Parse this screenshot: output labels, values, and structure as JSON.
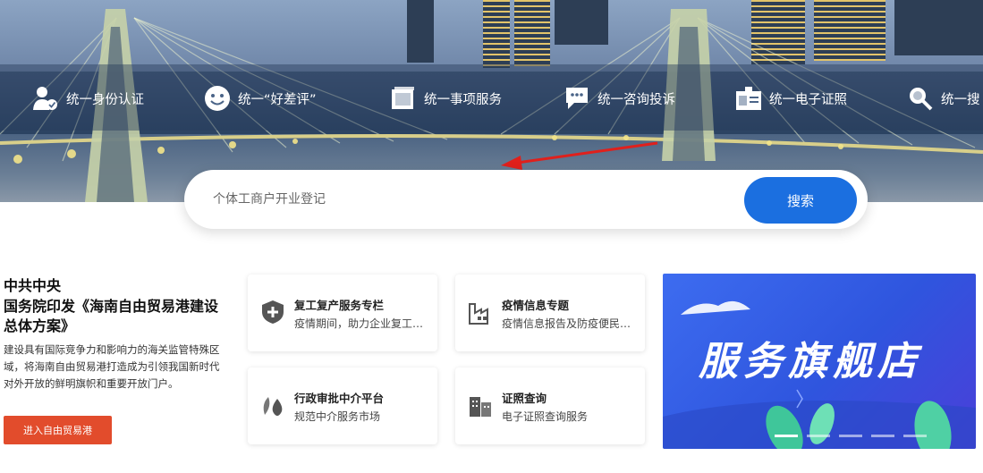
{
  "features": [
    {
      "label": "统一身份认证",
      "icon": "user-check-icon"
    },
    {
      "label": "统一“好差评”",
      "icon": "smiley-icon"
    },
    {
      "label": "统一事项服务",
      "icon": "stack-icon"
    },
    {
      "label": "统一咨询投诉",
      "icon": "chat-bubble-icon"
    },
    {
      "label": "统一电子证照",
      "icon": "id-card-icon"
    },
    {
      "label": "统一搜",
      "icon": "search-icon"
    }
  ],
  "search": {
    "placeholder": "个体工商户开业登记",
    "button_label": "搜索"
  },
  "promo": {
    "org": "中共中央",
    "title": "国务院印发《海南自由贸易港建设总体方案》",
    "desc": "建设具有国际竞争力和影响力的海关监管特殊区域，将海南自由贸易港打造成为引领我国新时代对外开放的鲜明旗帜和重要开放门户。",
    "button_label": "进入自由贸易港"
  },
  "cards": [
    {
      "title": "复工复产服务专栏",
      "desc": "疫情期间，助力企业复工复产",
      "icon": "shield-plus-icon"
    },
    {
      "title": "疫情信息专题",
      "desc": "疫情信息报告及防疫便民服务",
      "icon": "factory-icon"
    },
    {
      "title": "行政审批中介平台",
      "desc": "规范中介服务市场",
      "icon": "leaf-drop-icon"
    },
    {
      "title": "证照查询",
      "desc": "电子证照查询服务",
      "icon": "buildings-icon"
    }
  ],
  "flagship": {
    "title": "服务旗舰店"
  },
  "colors": {
    "primary": "#1b6fe0",
    "promo_button": "#e24c2c",
    "flagship_bg": "#3d6cf0",
    "annotation_arrow": "#e0201c"
  }
}
